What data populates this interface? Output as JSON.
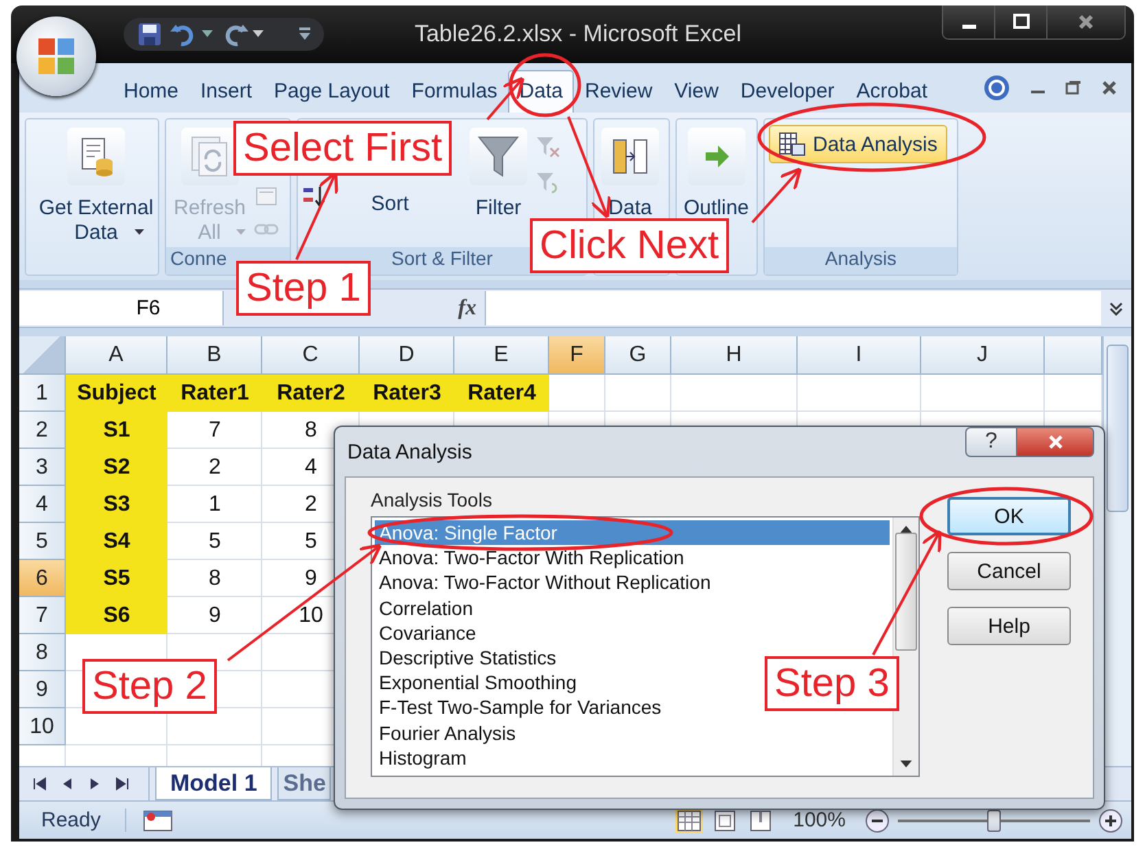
{
  "window": {
    "title": "Table26.2.xlsx - Microsoft Excel"
  },
  "ribbon_tabs": [
    {
      "label": "Home",
      "selected": false
    },
    {
      "label": "Insert",
      "selected": false
    },
    {
      "label": "Page Layout",
      "selected": false
    },
    {
      "label": "Formulas",
      "selected": false
    },
    {
      "label": "Data",
      "selected": true
    },
    {
      "label": "Review",
      "selected": false
    },
    {
      "label": "View",
      "selected": false
    },
    {
      "label": "Developer",
      "selected": false
    },
    {
      "label": "Acrobat",
      "selected": false
    }
  ],
  "ribbon_groups": [
    {
      "buttons": [
        {
          "label": "Get External Data",
          "kind": "large-menu",
          "disabled": false
        }
      ]
    },
    {
      "label": "Conne",
      "buttons": [
        {
          "label": "Refresh All",
          "kind": "large-menu",
          "disabled": true
        }
      ]
    },
    {
      "label": "Sort & Filter",
      "buttons": [
        {
          "label": "Sort",
          "kind": "text",
          "disabled": false
        },
        {
          "label": "Filter",
          "kind": "large",
          "disabled": false
        }
      ]
    },
    {
      "buttons": [
        {
          "label": "Data",
          "kind": "large",
          "disabled": false
        }
      ]
    },
    {
      "buttons": [
        {
          "label": "Outline",
          "kind": "large",
          "disabled": false
        }
      ]
    },
    {
      "label": "Analysis",
      "buttons": [
        {
          "label": "Data Analysis",
          "kind": "row",
          "disabled": false
        }
      ]
    }
  ],
  "formula_bar": {
    "name_box": "F6",
    "fx": "fx"
  },
  "columns": [
    {
      "label": "A",
      "selected": false
    },
    {
      "label": "B",
      "selected": false
    },
    {
      "label": "C",
      "selected": false
    },
    {
      "label": "D",
      "selected": false
    },
    {
      "label": "E",
      "selected": false
    },
    {
      "label": "F",
      "selected": true
    },
    {
      "label": "G",
      "selected": false
    },
    {
      "label": "H",
      "selected": false
    },
    {
      "label": "I",
      "selected": false
    },
    {
      "label": "J",
      "selected": false
    }
  ],
  "rows": [
    {
      "header": "1",
      "selected": false,
      "cells": [
        {
          "text": "Subject",
          "highlighted": true
        },
        {
          "text": "Rater1",
          "highlighted": true
        },
        {
          "text": "Rater2",
          "highlighted": true
        },
        {
          "text": "Rater3",
          "highlighted": true
        },
        {
          "text": "Rater4",
          "highlighted": true
        }
      ]
    },
    {
      "header": "2",
      "selected": false,
      "cells": [
        {
          "text": "S1",
          "highlighted": true
        },
        {
          "text": "7",
          "highlighted": false
        },
        {
          "text": "8",
          "highlighted": false
        }
      ]
    },
    {
      "header": "3",
      "selected": false,
      "cells": [
        {
          "text": "S2",
          "highlighted": true
        },
        {
          "text": "2",
          "highlighted": false
        },
        {
          "text": "4",
          "highlighted": false
        }
      ]
    },
    {
      "header": "4",
      "selected": false,
      "cells": [
        {
          "text": "S3",
          "highlighted": true
        },
        {
          "text": "1",
          "highlighted": false
        },
        {
          "text": "2",
          "highlighted": false
        }
      ]
    },
    {
      "header": "5",
      "selected": false,
      "cells": [
        {
          "text": "S4",
          "highlighted": true
        },
        {
          "text": "5",
          "highlighted": false
        },
        {
          "text": "5",
          "highlighted": false
        }
      ]
    },
    {
      "header": "6",
      "selected": true,
      "cells": [
        {
          "text": "S5",
          "highlighted": true
        },
        {
          "text": "8",
          "highlighted": false
        },
        {
          "text": "9",
          "highlighted": false
        }
      ]
    },
    {
      "header": "7",
      "selected": false,
      "cells": [
        {
          "text": "S6",
          "highlighted": true
        },
        {
          "text": "9",
          "highlighted": false
        },
        {
          "text": "10",
          "highlighted": false
        }
      ]
    },
    {
      "header": "8",
      "selected": false,
      "cells": []
    },
    {
      "header": "9",
      "selected": false,
      "cells": []
    },
    {
      "header": "10",
      "selected": false,
      "cells": []
    }
  ],
  "sheet_tabs": [
    {
      "label": "Model 1",
      "selected": true
    },
    {
      "label": "She",
      "selected": false
    }
  ],
  "status_bar": {
    "status": "Ready",
    "zoom": "100%",
    "zoom_slider": {
      "level": 0.5
    }
  },
  "dialog": {
    "title": "Data Analysis",
    "help": "?",
    "list_label": "Analysis Tools",
    "tools": [
      {
        "label": "Anova: Single Factor",
        "selected": true
      },
      {
        "label": "Anova: Two-Factor With Replication",
        "selected": false
      },
      {
        "label": "Anova: Two-Factor Without Replication",
        "selected": false
      },
      {
        "label": "Correlation",
        "selected": false
      },
      {
        "label": "Covariance",
        "selected": false
      },
      {
        "label": "Descriptive Statistics",
        "selected": false
      },
      {
        "label": "Exponential Smoothing",
        "selected": false
      },
      {
        "label": "F-Test Two-Sample for Variances",
        "selected": false
      },
      {
        "label": "Fourier Analysis",
        "selected": false
      },
      {
        "label": "Histogram",
        "selected": false
      }
    ],
    "buttons": [
      {
        "label": "OK",
        "default": true
      },
      {
        "label": "Cancel",
        "default": false
      },
      {
        "label": "Help",
        "default": false
      }
    ]
  },
  "callouts": [
    "Select First",
    "Step 1",
    "Click Next",
    "Step 2",
    "Step 3"
  ]
}
